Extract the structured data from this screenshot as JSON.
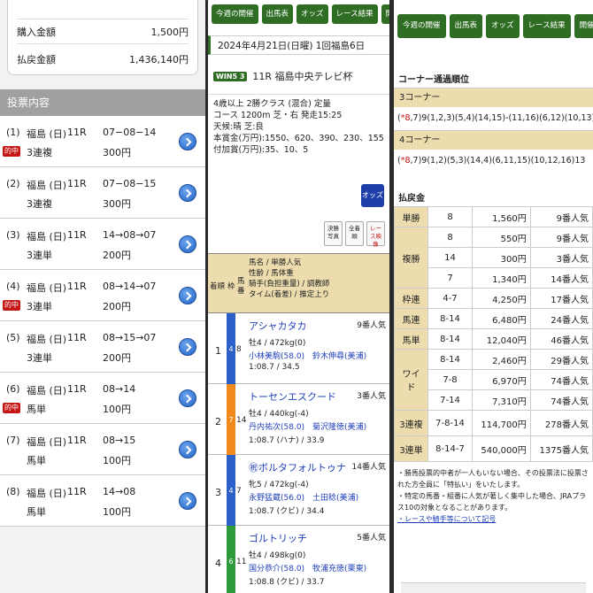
{
  "summary": {
    "purchase_label": "購入金額",
    "purchase_value": "1,500円",
    "payout_label": "払戻金額",
    "payout_value": "1,436,140円"
  },
  "bets_header": "投票内容",
  "bets": [
    {
      "no": "(1)",
      "place": "福島 (日)",
      "race": "11R",
      "combo": "07−08−14",
      "type": "3連複",
      "amount": "300円",
      "tag": "的中"
    },
    {
      "no": "(2)",
      "place": "福島 (日)",
      "race": "11R",
      "combo": "07−08−15",
      "type": "3連複",
      "amount": "300円",
      "tag": ""
    },
    {
      "no": "(3)",
      "place": "福島 (日)",
      "race": "11R",
      "combo": "14→08→07",
      "type": "3連単",
      "amount": "200円",
      "tag": ""
    },
    {
      "no": "(4)",
      "place": "福島 (日)",
      "race": "11R",
      "combo": "08→14→07",
      "type": "3連単",
      "amount": "200円",
      "tag": "的中"
    },
    {
      "no": "(5)",
      "place": "福島 (日)",
      "race": "11R",
      "combo": "08→15→07",
      "type": "3連単",
      "amount": "200円",
      "tag": ""
    },
    {
      "no": "(6)",
      "place": "福島 (日)",
      "race": "11R",
      "combo": "08→14",
      "type": "馬単",
      "amount": "100円",
      "tag": "的中"
    },
    {
      "no": "(7)",
      "place": "福島 (日)",
      "race": "11R",
      "combo": "08→15",
      "type": "馬単",
      "amount": "100円",
      "tag": ""
    },
    {
      "no": "(8)",
      "place": "福島 (日)",
      "race": "11R",
      "combo": "14→08",
      "type": "馬単",
      "amount": "100円",
      "tag": ""
    }
  ],
  "nav": [
    "今週の開催",
    "出馬表",
    "オッズ",
    "レース結果",
    "開催日"
  ],
  "nav3": [
    "今週の開催",
    "出馬表",
    "オッズ",
    "レース結果",
    "開催日"
  ],
  "race": {
    "date": "2024年4月21日(日曜) 1回福島6日",
    "logo": "WIN5 3",
    "title": "11R 福島中央テレビ杯",
    "cond1": "4歳以上 2勝クラス (混合) 定量",
    "cond2": "コース 1200m 芝・右 発走15:25",
    "cond3": "天候:晴 芝:良",
    "cond4": "本賞金(万円):1550、620、390、230、155",
    "cond5": "付加賞(万円):35、10、5",
    "odds_btn": "オッズ",
    "btn_a": "決勝写真",
    "btn_b": "全着順",
    "btn_c": "レース映像"
  },
  "table_head": {
    "pos": "着順",
    "waku": "枠",
    "uma": "馬番",
    "info": "馬名 / 単勝人気\n性齢 / 馬体重\n騎手(負担重量) / 調教師\nタイム(着差) / 推定上り"
  },
  "horses": [
    {
      "pos": "1",
      "waku": "4",
      "uma": "8",
      "name": "アシャカタカ",
      "pop": "9番人気",
      "sex": "牡4 / 472kg(0)",
      "jockey": "小林美駒(58.0)　鈴木伸尋(美浦)",
      "time": "1:08.7 / 34.5",
      "wcol": "#2c5fc7",
      "wtext": "#fff"
    },
    {
      "pos": "2",
      "waku": "7",
      "uma": "14",
      "name": "トーセンエスクード",
      "pop": "3番人気",
      "sex": "牡4 / 440kg(-4)",
      "jockey": "丹内祐次(58.0)　菊沢隆徳(美浦)",
      "time": "1:08.7 (ハナ) / 33.9",
      "wcol": "#f08a1c",
      "wtext": "#fff"
    },
    {
      "pos": "3",
      "waku": "4",
      "uma": "7",
      "name": "㊗ボルタフォルトゥナ",
      "pop": "14番人気",
      "sex": "牝5 / 472kg(-4)",
      "jockey": "永野猛蔵(56.0)　土田稔(美浦)",
      "time": "1:08.7 (クビ) / 34.4",
      "wcol": "#2c5fc7",
      "wtext": "#fff"
    },
    {
      "pos": "4",
      "waku": "6",
      "uma": "11",
      "name": "ゴルトリッチ",
      "pop": "5番人気",
      "sex": "牡4 / 498kg(0)",
      "jockey": "国分恭介(58.0)　牧浦充徳(栗東)",
      "time": "1:08.8 (クビ) / 33.7",
      "wcol": "#2e9b3a",
      "wtext": "#fff"
    }
  ],
  "corner": {
    "title": "コーナー通過順位",
    "c3_label": "3コーナー",
    "c3_hl": "*8",
    "c3_rest": ",7)9(1,2,3)(5,4)(14,15)-(11,16)(6,12)(10,13)",
    "c3_open": "(",
    "c4_label": "4コーナー",
    "c4_hl": "*8",
    "c4_rest": ",7)9(1,2)(5,3)(14,4)(6,11,15)(10,12,16)13",
    "c4_open": "("
  },
  "payout": {
    "title": "払戻金",
    "rows": [
      {
        "type": "単勝",
        "kumi": "8",
        "yen": "1,560円",
        "pop": "9番人気",
        "span": 1
      },
      {
        "type": "複勝",
        "kumi": "8",
        "yen": "550円",
        "pop": "9番人気",
        "span": 3
      },
      {
        "type": "",
        "kumi": "14",
        "yen": "300円",
        "pop": "3番人気",
        "span": 0
      },
      {
        "type": "",
        "kumi": "7",
        "yen": "1,340円",
        "pop": "14番人気",
        "span": 0
      },
      {
        "type": "枠連",
        "kumi": "4-7",
        "yen": "4,250円",
        "pop": "17番人気",
        "span": 1
      },
      {
        "type": "馬連",
        "kumi": "8-14",
        "yen": "6,480円",
        "pop": "24番人気",
        "span": 1
      },
      {
        "type": "馬単",
        "kumi": "8-14",
        "yen": "12,040円",
        "pop": "46番人気",
        "span": 1
      },
      {
        "type": "ワイド",
        "kumi": "8-14",
        "yen": "2,460円",
        "pop": "29番人気",
        "span": 3
      },
      {
        "type": "",
        "kumi": "7-8",
        "yen": "6,970円",
        "pop": "74番人気",
        "span": 0
      },
      {
        "type": "",
        "kumi": "7-14",
        "yen": "7,310円",
        "pop": "74番人気",
        "span": 0
      },
      {
        "type": "3連複",
        "kumi": "7-8-14",
        "yen": "114,700円",
        "pop": "278番人気",
        "span": 1
      },
      {
        "type": "3連単",
        "kumi": "8-14-7",
        "yen": "540,000円",
        "pop": "1375番人気",
        "span": 1
      }
    ]
  },
  "notes": {
    "n1": "・勝馬投票的中者が一人もいない場合、その投票法に投票された方全員に「特払い」をいたします。",
    "n2": "・特定の馬番・組番に人気が著しく集中した場合、JRAプラス10の対象となることがあります。",
    "n3": "・レースや騎手等について記号"
  }
}
